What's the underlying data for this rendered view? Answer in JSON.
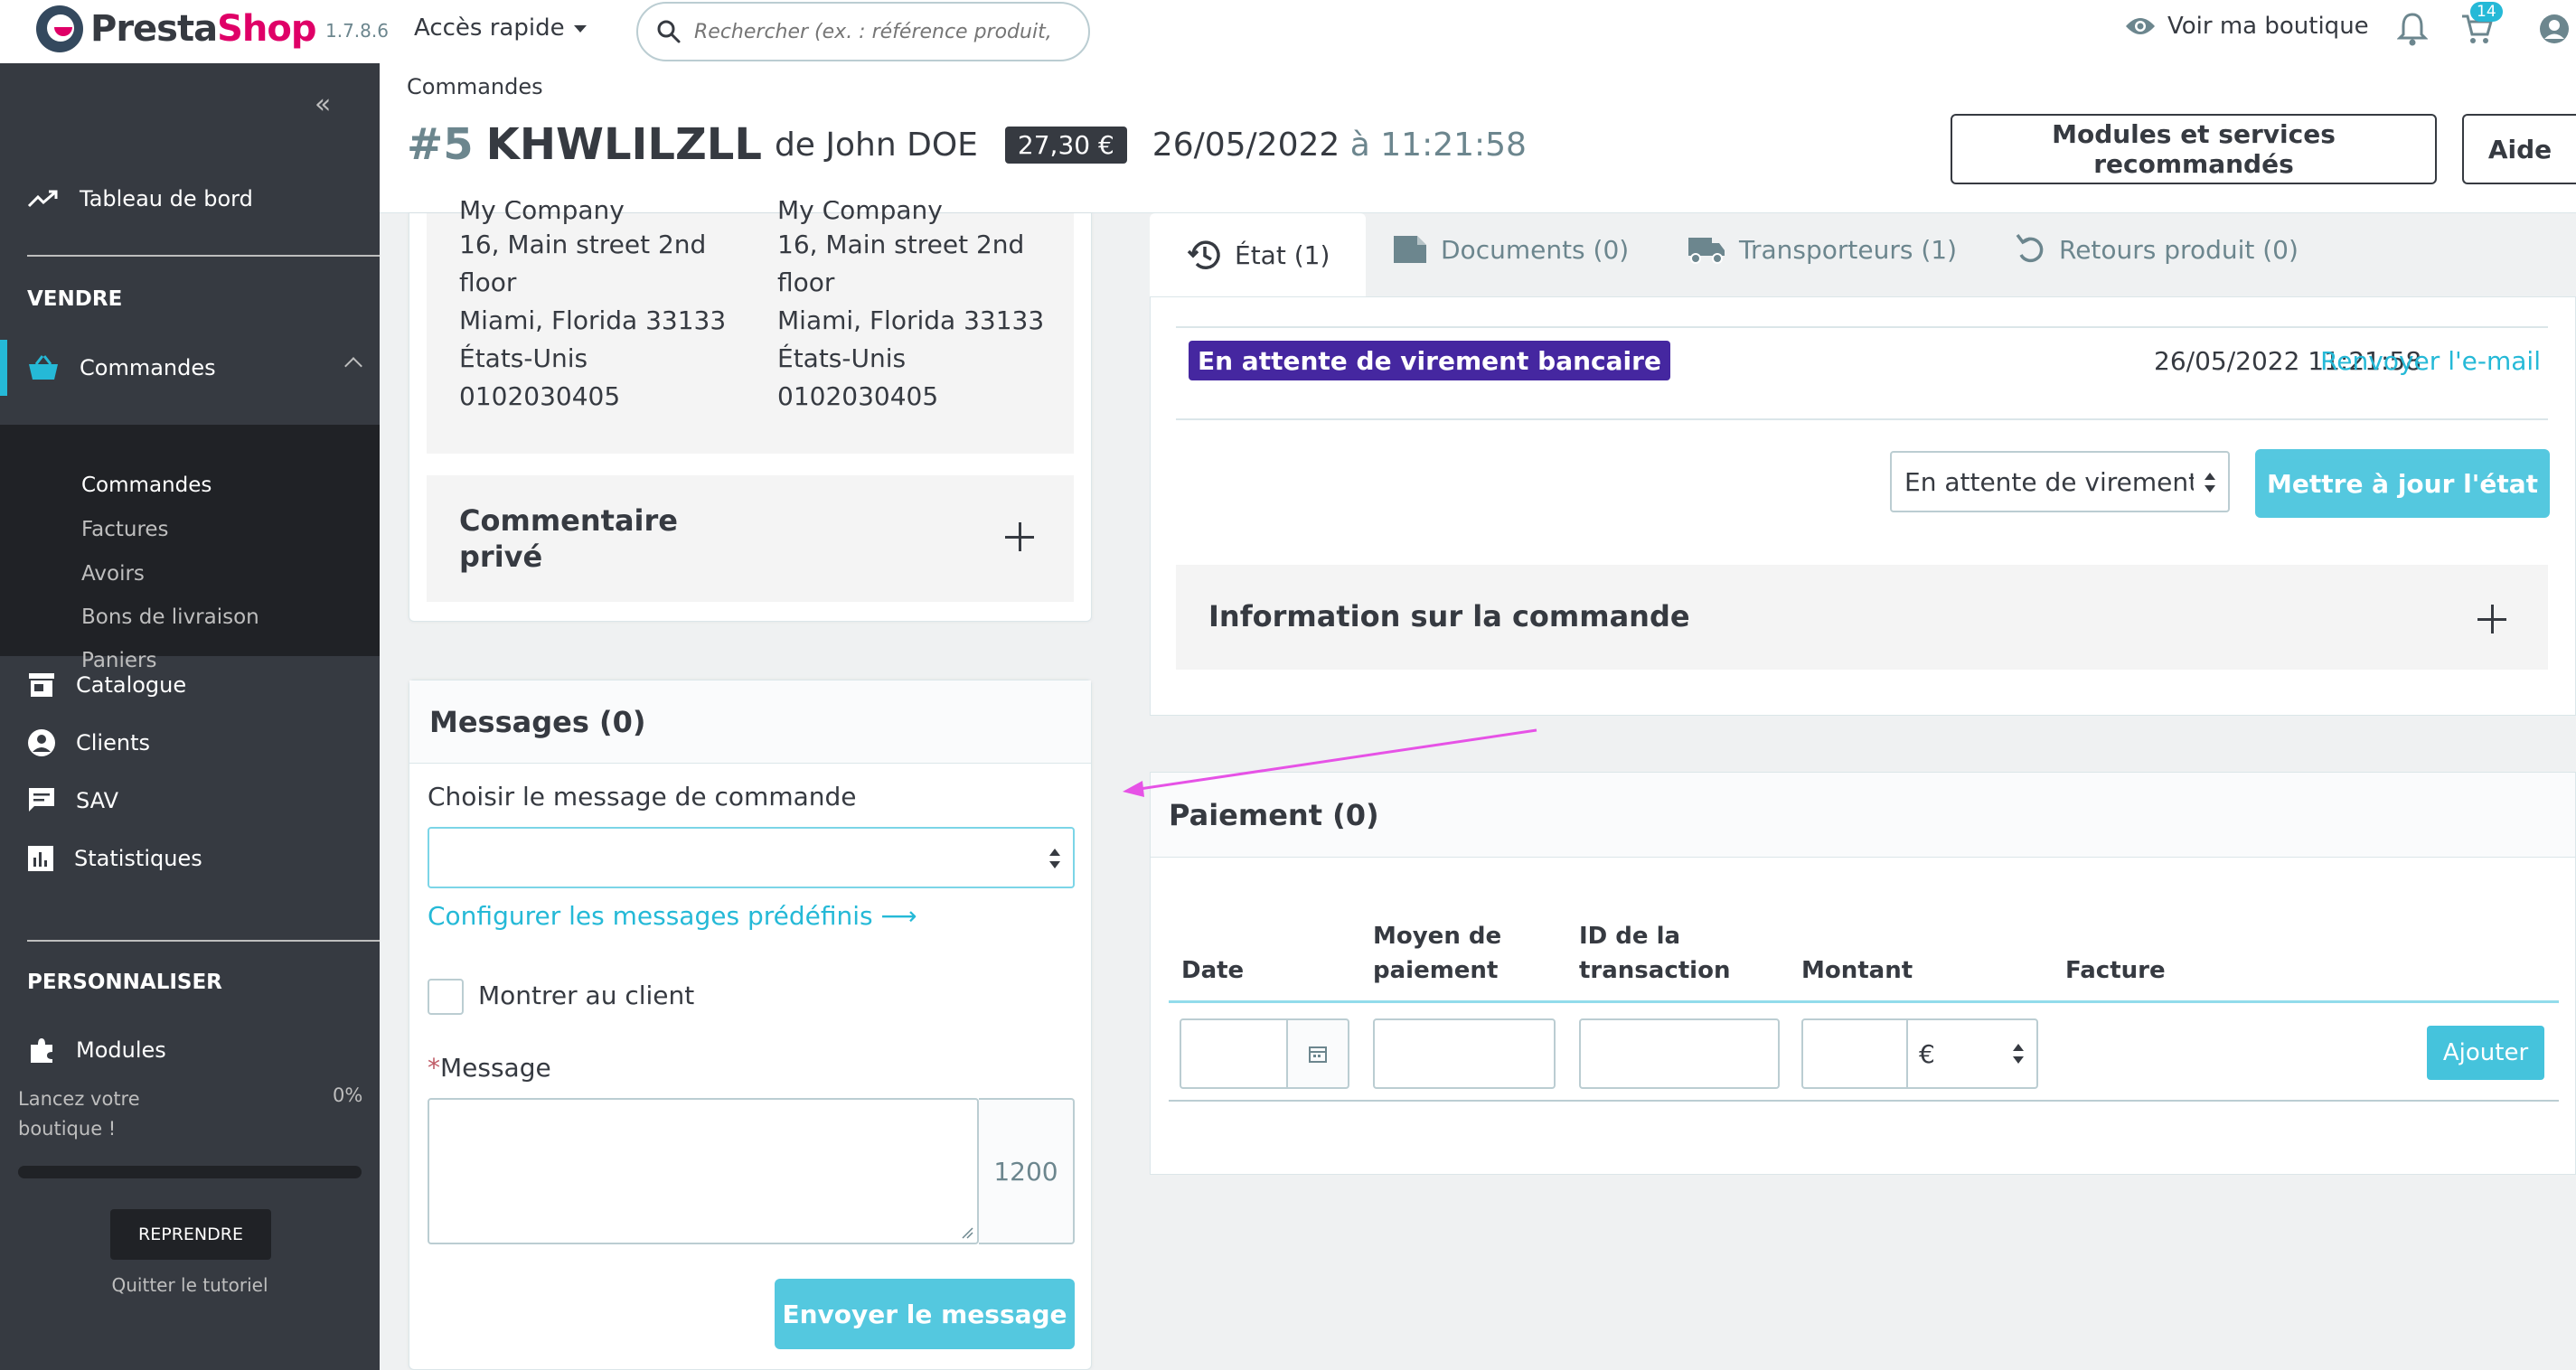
{
  "topbar": {
    "logo_presta": "Presta",
    "logo_shop": "Shop",
    "version": "1.7.8.6",
    "quick_access": "Accès rapide",
    "search_placeholder": "Rechercher (ex. : référence produit, no",
    "view_shop": "Voir ma boutique",
    "cart_badge": "14"
  },
  "sidebar": {
    "dashboard": "Tableau de bord",
    "section_sell": "VENDRE",
    "orders": "Commandes",
    "orders_sub": [
      "Commandes",
      "Factures",
      "Avoirs",
      "Bons de livraison",
      "Paniers"
    ],
    "catalog": "Catalogue",
    "customers": "Clients",
    "support": "SAV",
    "stats": "Statistiques",
    "section_customize": "PERSONNALISER",
    "modules": "Modules",
    "onboarding_text": "Lancez votre boutique !",
    "onboarding_pct": "0%",
    "onboarding_progress": 0,
    "resume": "REPRENDRE",
    "quit": "Quitter le tutoriel"
  },
  "header": {
    "breadcrumb": "Commandes",
    "order_num": "#5",
    "order_ref": "KHWLILZLL",
    "customer": "de John DOE",
    "total": "27,30 €",
    "date": "26/05/2022",
    "at": "à",
    "time": "11:21:58",
    "btn_modules": "Modules et services recommandés",
    "btn_help": "Aide"
  },
  "address": {
    "left": [
      "My Company",
      "16, Main street 2nd",
      "floor",
      "Miami, Florida 33133",
      "États-Unis",
      "0102030405"
    ],
    "right": [
      "My Company",
      "16, Main street 2nd",
      "floor",
      "Miami, Florida 33133",
      "États-Unis",
      "0102030405"
    ]
  },
  "comment": {
    "title": "Commentaire privé"
  },
  "messages": {
    "title": "Messages (0)",
    "choose_label": "Choisir le message de commande",
    "configure_link": "Configurer les messages prédéfinis ⟶",
    "show_customer": "Montrer au client",
    "required_mark": "*",
    "message_label": "Message",
    "counter": "1200",
    "send": "Envoyer le message"
  },
  "tabs": {
    "status": "État (1)",
    "documents": "Documents (0)",
    "carriers": "Transporteurs (1)",
    "returns": "Retours produit (0)"
  },
  "status": {
    "badge": "En attente de virement bancaire",
    "badge_color": "#4527a0",
    "date": "26/05/2022 11:21:58",
    "resend": "Renvoyer l'e-mail",
    "select_value": "En attente de virement bancaire",
    "update": "Mettre à jour l'état",
    "order_info": "Information sur la commande"
  },
  "payment": {
    "title": "Paiement (0)",
    "col_date": "Date",
    "col_method_1": "Moyen de",
    "col_method_2": "paiement",
    "col_tx_1": "ID de la",
    "col_tx_2": "transaction",
    "col_amount": "Montant",
    "col_invoice": "Facture",
    "currency": "€",
    "add": "Ajouter"
  },
  "colors": {
    "accent": "#25b9d7",
    "sidebar": "#363a41",
    "annotation_arrow": "#e652e6"
  }
}
